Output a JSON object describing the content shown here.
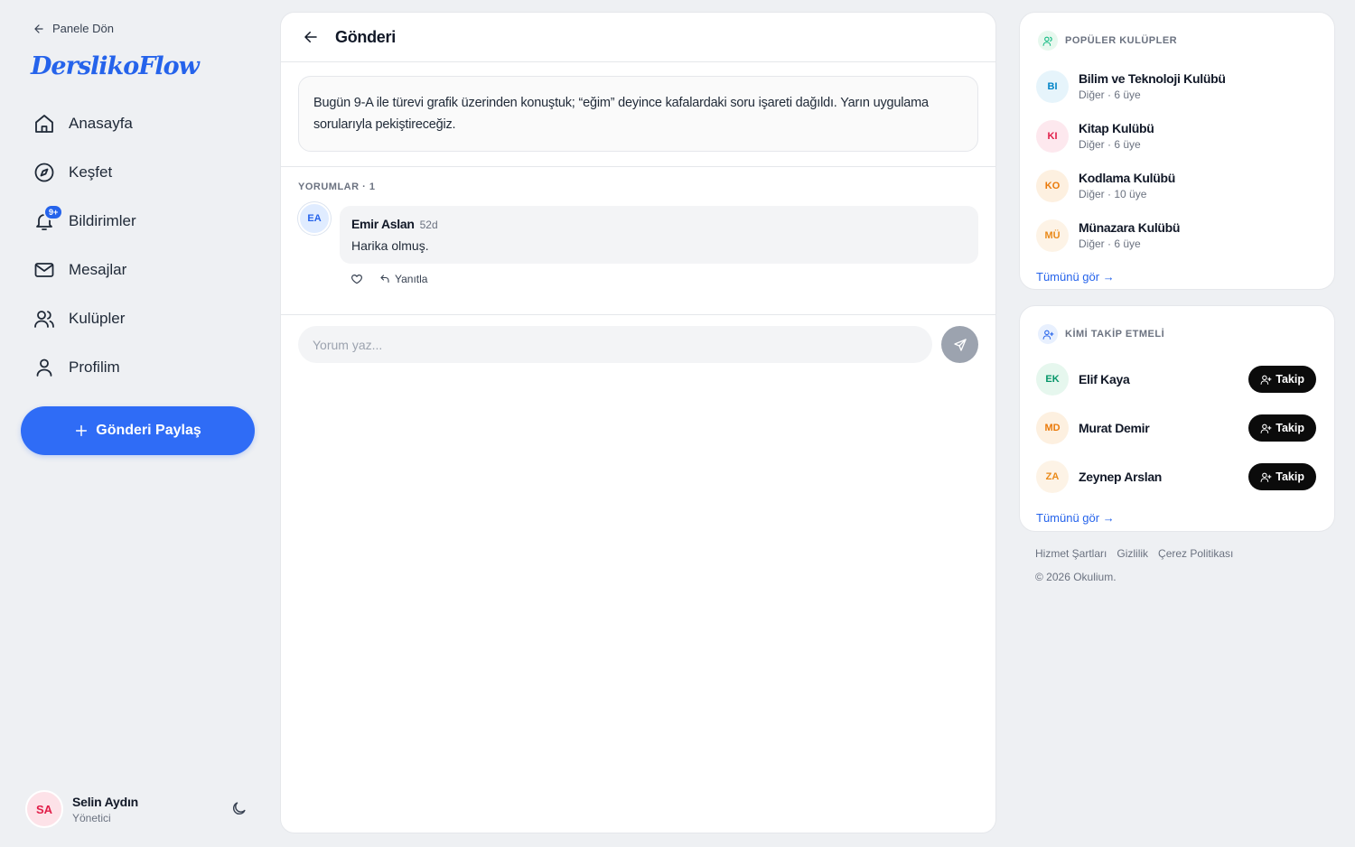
{
  "sidebar": {
    "back_label": "Panele Dön",
    "logo_text": "DerslikoFlow",
    "nav": [
      {
        "label": "Anasayfa",
        "icon": "home-icon"
      },
      {
        "label": "Keşfet",
        "icon": "compass-icon"
      },
      {
        "label": "Bildirimler",
        "icon": "bell-icon",
        "badge": "9+"
      },
      {
        "label": "Mesajlar",
        "icon": "mail-icon"
      },
      {
        "label": "Kulüpler",
        "icon": "users-icon"
      },
      {
        "label": "Profilim",
        "icon": "user-icon"
      }
    ],
    "share_label": "Gönderi Paylaş",
    "user": {
      "initials": "SA",
      "name": "Selin Aydın",
      "role": "Yönetici"
    }
  },
  "main": {
    "title": "Gönderi",
    "post_text": "Bugün 9-A ile türevi grafik üzerinden konuştuk; “eğim” deyince kafalardaki soru işareti dağıldı. Yarın uygulama sorularıyla pekiştireceğiz.",
    "comments_header": "YORUMLAR · 1",
    "comments": [
      {
        "initials": "EA",
        "author": "Emir Aslan",
        "time": "52d",
        "text": "Harika olmuş.",
        "reply_label": "Yanıtla"
      }
    ],
    "compose_placeholder": "Yorum yaz..."
  },
  "popular_clubs": {
    "title": "POPÜLER KULÜPLER",
    "clubs": [
      {
        "initials": "BI",
        "name": "Bilim ve Teknoloji Kulübü",
        "meta": "Diğer · 6 üye",
        "bg": "#e6f4fb",
        "fg": "#0284c7"
      },
      {
        "initials": "KI",
        "name": "Kitap Kulübü",
        "meta": "Diğer · 6 üye",
        "bg": "#fde8ee",
        "fg": "#e11d48"
      },
      {
        "initials": "KO",
        "name": "Kodlama Kulübü",
        "meta": "Diğer · 10 üye",
        "bg": "#fdf0e0",
        "fg": "#ea7a0b"
      },
      {
        "initials": "MÜ",
        "name": "Münazara Kulübü",
        "meta": "Diğer · 6 üye",
        "bg": "#fdf3e6",
        "fg": "#ea8a1a"
      }
    ],
    "see_all": "Tümünü gör →"
  },
  "who_to_follow": {
    "title": "KİMİ TAKİP ETMELİ",
    "people": [
      {
        "initials": "EK",
        "name": "Elif Kaya",
        "bg": "#e6f7ee",
        "fg": "#059669"
      },
      {
        "initials": "MD",
        "name": "Murat Demir",
        "bg": "#fdf0e0",
        "fg": "#ea7a0b"
      },
      {
        "initials": "ZA",
        "name": "Zeynep Arslan",
        "bg": "#fdf3e6",
        "fg": "#ea8a1a"
      }
    ],
    "follow_label": "Takip",
    "see_all": "Tümünü gör →"
  },
  "footer": {
    "links": [
      "Hizmet Şartları",
      "Gizlilik",
      "Çerez Politikası"
    ],
    "copyright": "© 2026 Okulium."
  }
}
